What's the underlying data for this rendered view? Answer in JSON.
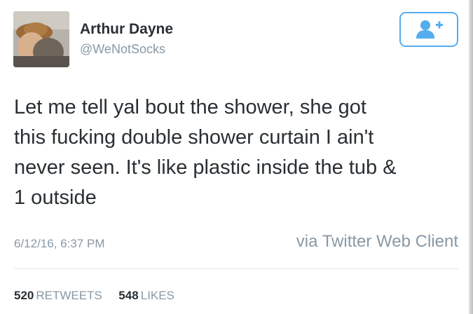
{
  "tweet": {
    "author": {
      "display_name": "Arthur Dayne",
      "handle": "@WeNotSocks",
      "avatar": "avatar-photo"
    },
    "follow_button": {
      "icon": "add-user-icon",
      "color": "#55acee"
    },
    "text": "Let me tell yal bout the shower, she got\nthis fucking double shower curtain I ain't\nnever seen. It's like plastic inside the tub &\n1 outside",
    "timestamp": "6/12/16, 6:37 PM",
    "source": "via Twitter Web Client",
    "stats": {
      "retweets_count": "520",
      "retweets_label": "RETWEETS",
      "likes_count": "548",
      "likes_label": "LIKES"
    }
  },
  "colors": {
    "text": "#292f33",
    "muted": "#8899a6",
    "accent": "#55acee",
    "divider": "#e1e8ed"
  }
}
